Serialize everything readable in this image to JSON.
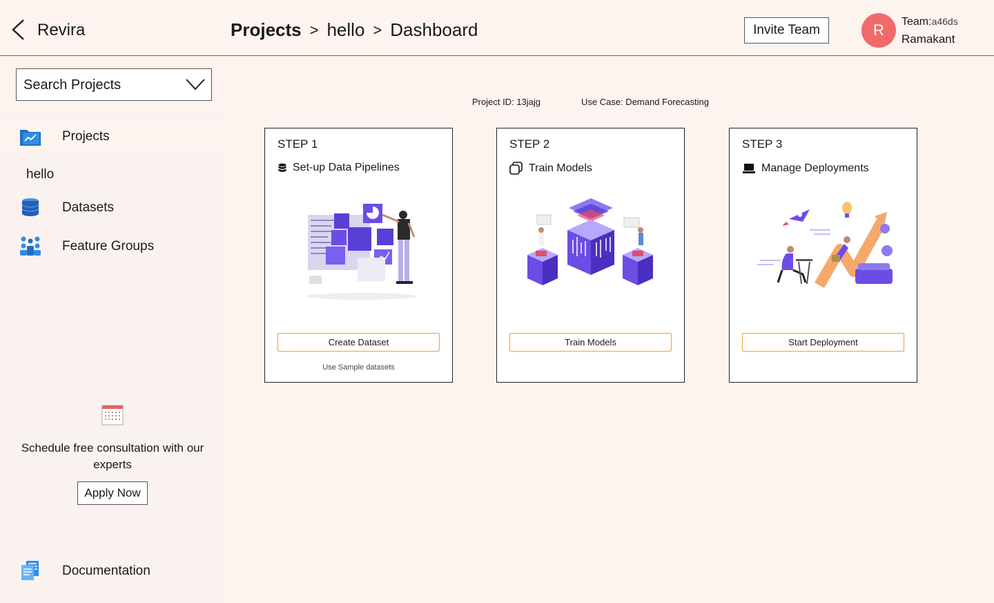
{
  "app": {
    "name": "Revira"
  },
  "sidebar": {
    "search_label": "Search Projects",
    "items": [
      {
        "label": "Projects",
        "icon": "chart-folder-icon"
      },
      {
        "label": "Datasets",
        "icon": "database-icon"
      },
      {
        "label": "Feature Groups",
        "icon": "people-group-icon"
      }
    ],
    "current_project": "hello",
    "consult_text": "Schedule free consultation with our experts",
    "apply_label": "Apply Now",
    "docs_label": "Documentation"
  },
  "header": {
    "crumbs": [
      "Projects",
      "hello",
      "Dashboard"
    ],
    "separator": ">",
    "invite_label": "Invite Team",
    "avatar_letter": "R",
    "team_label": "Team:",
    "team_value": "a46ds",
    "user_name": "Ramakant"
  },
  "meta": {
    "project_id": "Project ID: 13jajg",
    "use_case": "Use Case: Demand Forecasting"
  },
  "steps": [
    {
      "step": "STEP 1",
      "title": "Set-up Data Pipelines",
      "icon": "database-stack-icon",
      "button": "Create Dataset",
      "link": "Use Sample datasets"
    },
    {
      "step": "STEP 2",
      "title": "Train Models",
      "icon": "copy-layers-icon",
      "button": "Train Models"
    },
    {
      "step": "STEP 3",
      "title": "Manage Deployments",
      "icon": "laptop-icon",
      "button": "Start Deployment"
    }
  ],
  "colors": {
    "accent_border": "#f0a03c",
    "avatar": "#f06a6a",
    "background": "#fdf3ef",
    "illustration": "#6b4de6"
  }
}
